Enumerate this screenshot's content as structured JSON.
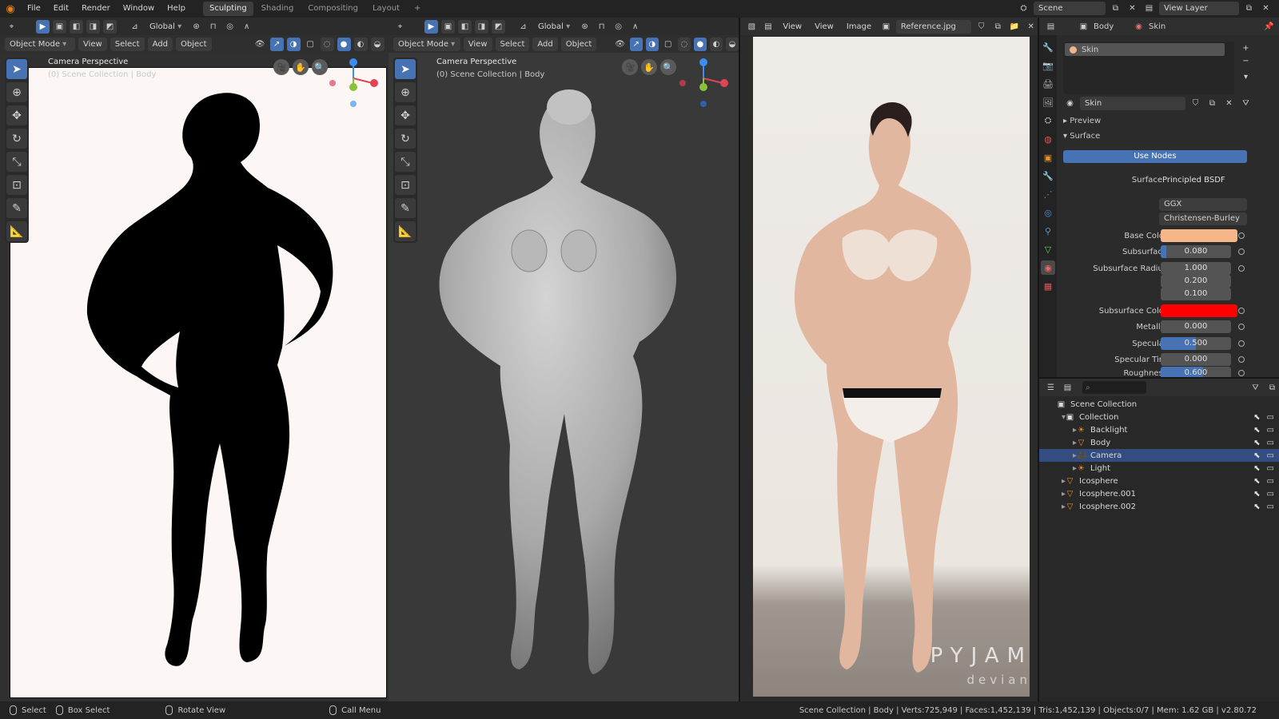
{
  "topbar": {
    "menus": [
      "File",
      "Edit",
      "Render",
      "Window",
      "Help"
    ],
    "workspaces": [
      "Sculpting",
      "Shading",
      "Compositing",
      "Layout"
    ],
    "add_tab": "+",
    "scene": "Scene",
    "view_layer": "View Layer"
  },
  "viewport_left": {
    "mode": "Object Mode",
    "menus": [
      "View",
      "Select",
      "Add",
      "Object"
    ],
    "orientation": "Global",
    "camera_label": "Camera Perspective",
    "collection_label": "(0) Scene Collection | Body"
  },
  "viewport_mid": {
    "mode": "Object Mode",
    "menus": [
      "View",
      "Select",
      "Add",
      "Object"
    ],
    "orientation": "Global",
    "camera_label": "Camera Perspective",
    "collection_label": "(0) Scene Collection | Body"
  },
  "image_editor": {
    "menus": [
      "View",
      "View",
      "Image"
    ],
    "image_name": "Reference.jpg",
    "watermark": "PYJAM",
    "watermark_sub": "devian"
  },
  "properties": {
    "object_name": "Body",
    "material_tab": "Skin",
    "slot_name": "Skin",
    "material_name": "Skin",
    "preview_label": "Preview",
    "surface_label": "Surface",
    "use_nodes": "Use Nodes",
    "surface_field_label": "Surface",
    "surface_shader": "Principled BSDF",
    "distribution": "GGX",
    "subsurface_method": "Christensen-Burley",
    "rows": [
      {
        "label": "Base Color",
        "value": "",
        "color": "#f5b689"
      },
      {
        "label": "Subsurface",
        "value": "0.080",
        "fill": 0.08
      },
      {
        "label": "Subsurface Radius",
        "value": "1.000"
      },
      {
        "label": "",
        "value": "0.200"
      },
      {
        "label": "",
        "value": "0.100"
      },
      {
        "label": "Subsurface Color",
        "value": "",
        "color": "#ff0000"
      },
      {
        "label": "Metallic",
        "value": "0.000"
      },
      {
        "label": "Specular",
        "value": "0.500",
        "fill": 0.5
      },
      {
        "label": "Specular Tint",
        "value": "0.000"
      },
      {
        "label": "Roughness",
        "value": "0.600",
        "fill": 0.6
      }
    ]
  },
  "outliner": {
    "root": "Scene Collection",
    "items": [
      {
        "label": "Collection",
        "indent": 1,
        "icon": "collection-icon"
      },
      {
        "label": "Backlight",
        "indent": 2,
        "icon": "light-icon"
      },
      {
        "label": "Body",
        "indent": 2,
        "icon": "mesh-icon"
      },
      {
        "label": "Camera",
        "indent": 2,
        "icon": "camera-icon",
        "selected": true
      },
      {
        "label": "Light",
        "indent": 2,
        "icon": "light-icon"
      },
      {
        "label": "Icosphere",
        "indent": 1,
        "icon": "mesh-icon"
      },
      {
        "label": "Icosphere.001",
        "indent": 1,
        "icon": "mesh-icon"
      },
      {
        "label": "Icosphere.002",
        "indent": 1,
        "icon": "mesh-icon"
      }
    ]
  },
  "statusbar": {
    "select": "Select",
    "box_select": "Box Select",
    "rotate": "Rotate View",
    "call_menu": "Call Menu",
    "stats": "Scene Collection | Body | Verts:725,949 | Faces:1,452,139 | Tris:1,452,139 | Objects:0/7 | Mem: 1.62 GB | v2.80.72"
  },
  "colors": {
    "accent": "#4772b3",
    "gizmo_x": "#e34356",
    "gizmo_y": "#8bc13d",
    "gizmo_z": "#3b8ef0"
  }
}
